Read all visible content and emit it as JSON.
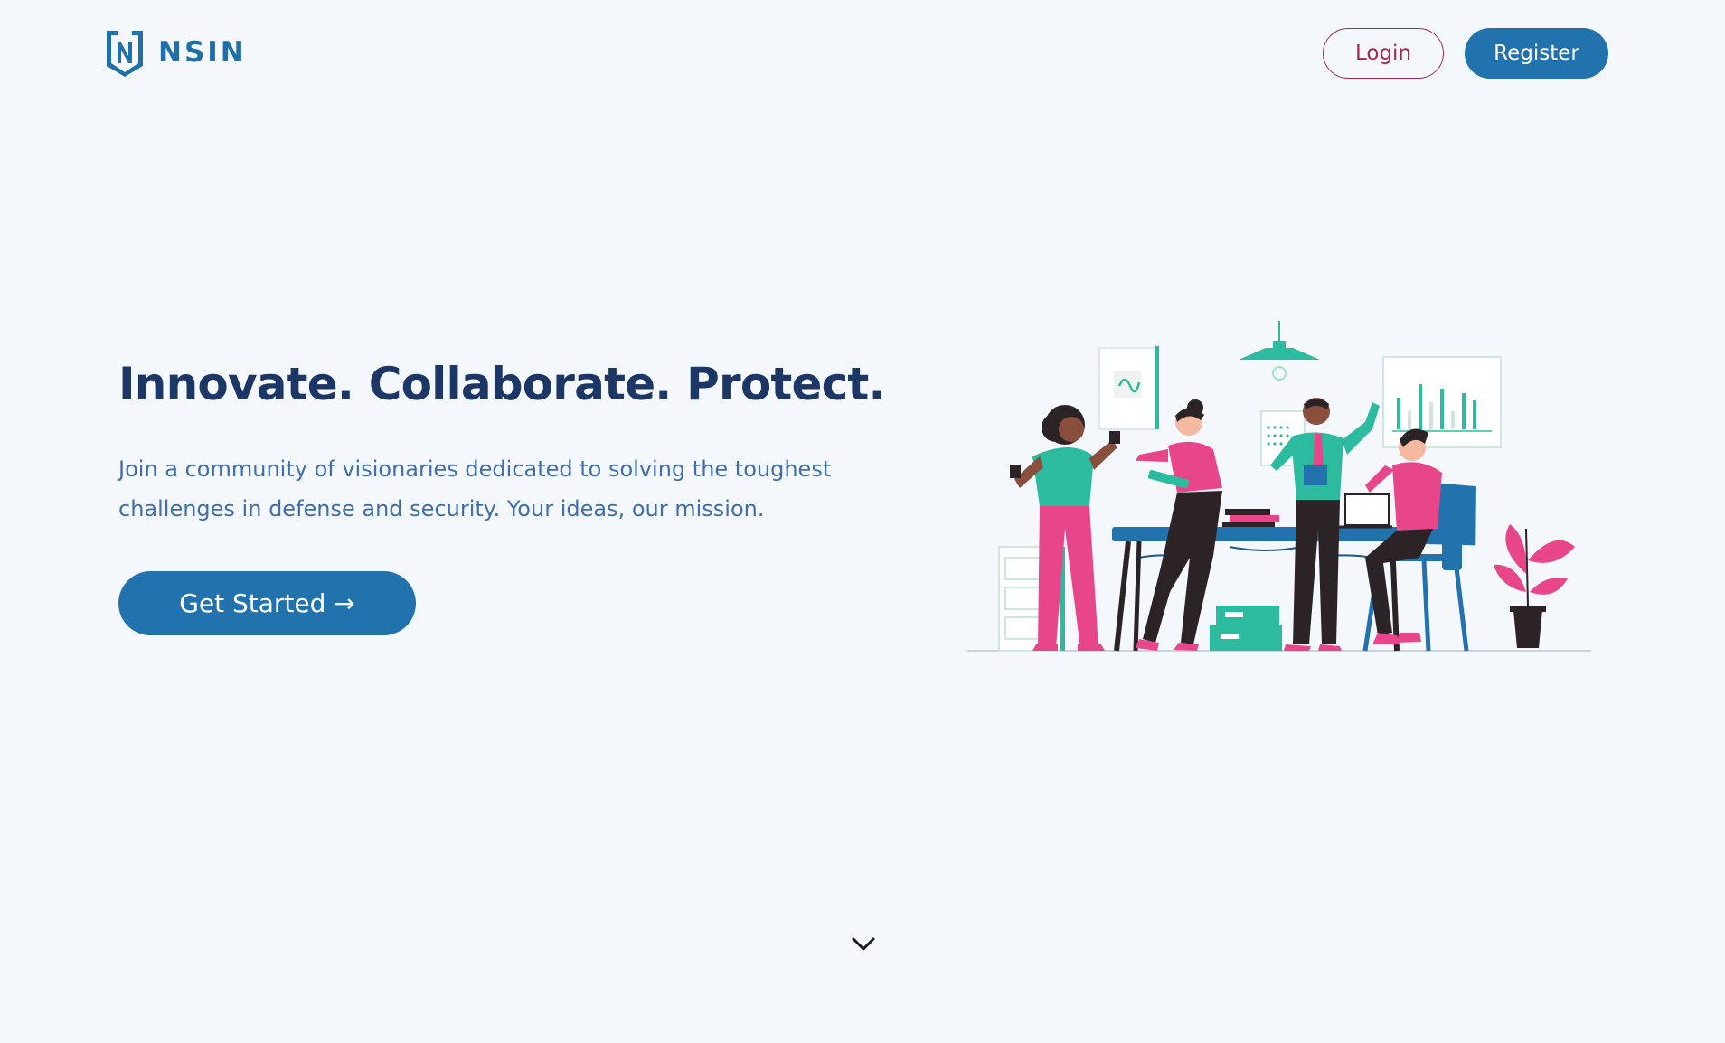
{
  "header": {
    "logo_text": "NSIN",
    "login_label": "Login",
    "register_label": "Register"
  },
  "hero": {
    "title": "Innovate. Collaborate. Protect.",
    "subtitle": "Join a community of visionaries dedicated to solving the toughest challenges in defense and security. Your ideas, our mission.",
    "cta_label": "Get Started →"
  },
  "icons": {
    "logo": "nsin-shield-logo",
    "illustration": "team-collaboration-illustration",
    "scroll": "chevron-down-icon"
  },
  "colors": {
    "background": "#f4f8fd",
    "primary": "#2172ad",
    "heading": "#1c3766",
    "subtitle": "#3f6eab",
    "login_accent": "#a1284f",
    "illustration_teal": "#2dbba0",
    "illustration_pink": "#e8468a",
    "illustration_dark": "#2b2326"
  }
}
